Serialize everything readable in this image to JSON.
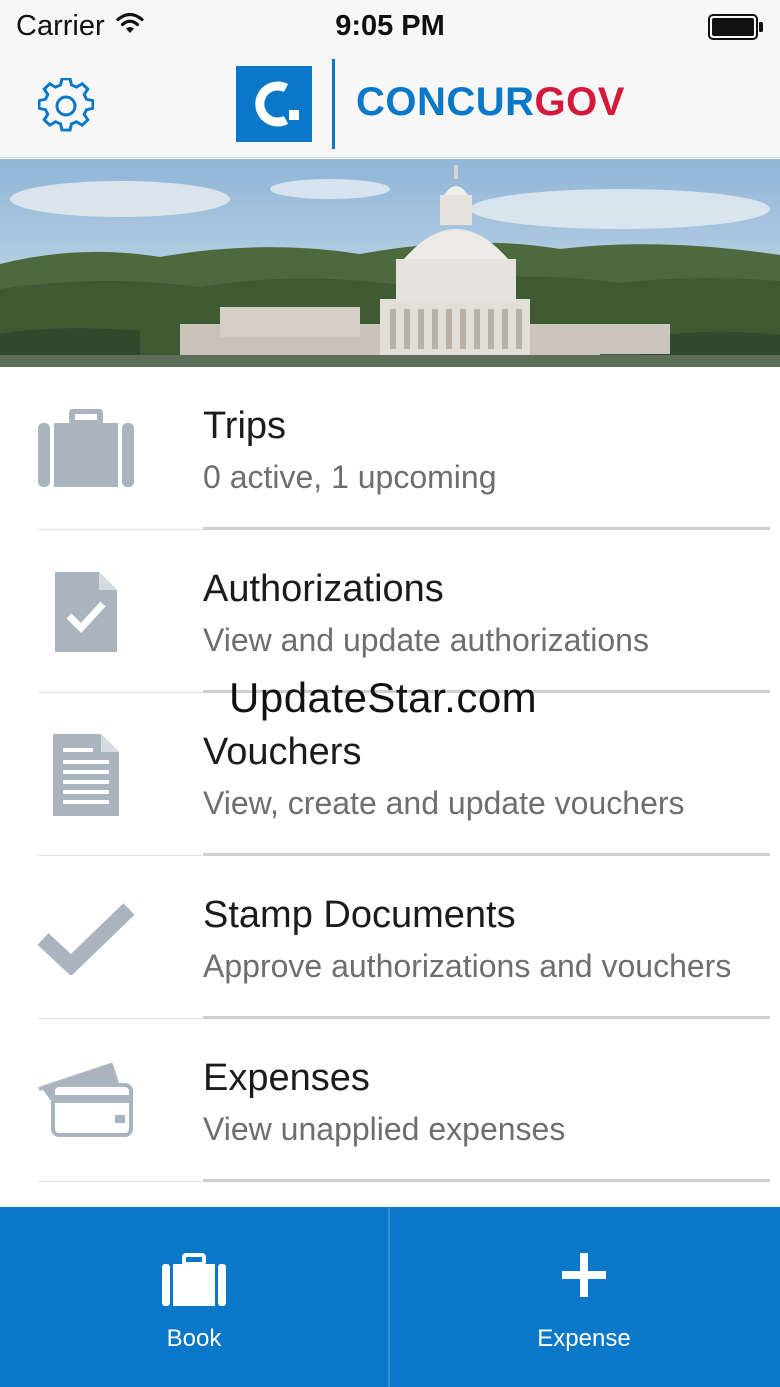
{
  "status_bar": {
    "carrier": "Carrier",
    "time": "9:05 PM"
  },
  "header": {
    "logo_letter": "C.",
    "brand_part1": "CONCUR",
    "brand_part2": "GOV",
    "settings_icon": "gear-icon"
  },
  "menu": [
    {
      "icon": "briefcase-icon",
      "title": "Trips",
      "subtitle": "0 active, 1 upcoming"
    },
    {
      "icon": "document-check-icon",
      "title": "Authorizations",
      "subtitle": "View and update authorizations"
    },
    {
      "icon": "document-lines-icon",
      "title": "Vouchers",
      "subtitle": "View, create and update vouchers"
    },
    {
      "icon": "checkmark-icon",
      "title": "Stamp Documents",
      "subtitle": "Approve authorizations and vouchers"
    },
    {
      "icon": "credit-card-icon",
      "title": "Expenses",
      "subtitle": "View unapplied expenses"
    }
  ],
  "watermark": "UpdateStar.com",
  "bottom_bar": {
    "book_label": "Book",
    "expense_label": "Expense"
  },
  "colors": {
    "brand_blue": "#0a78c8",
    "brand_red": "#d4193a",
    "icon_gray": "#a9b4bf"
  }
}
